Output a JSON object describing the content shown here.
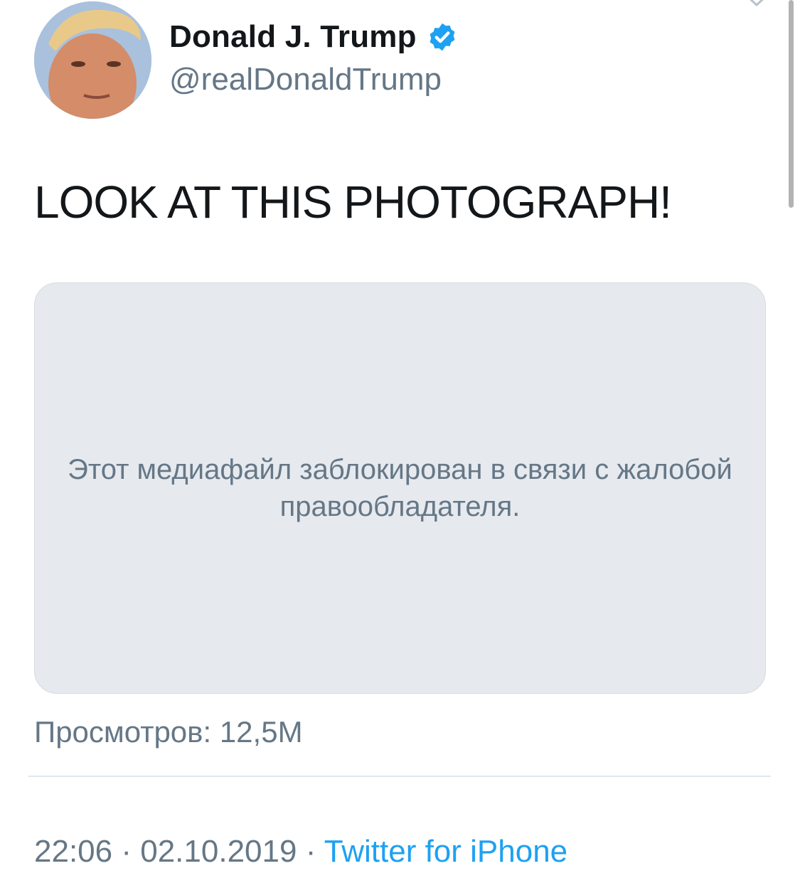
{
  "author": {
    "display_name": "Donald J. Trump",
    "handle": "@realDonaldTrump",
    "verified": true,
    "verified_color": "#1da1f2"
  },
  "tweet": {
    "text": "LOOK AT THIS PHOTOGRAPH!",
    "media_blocked_message": "Этот медиафайл заблокирован в связи с жалобой правообладателя.",
    "views": "Просмотров: 12,5M",
    "time": "22:06",
    "date": "02.10.2019",
    "separator": "·",
    "source": "Twitter for iPhone"
  },
  "icons": {
    "verified": "verified-check-icon",
    "menu": "chevron-down-icon"
  },
  "colors": {
    "primary_text": "#14171a",
    "secondary_text": "#657786",
    "link": "#1da1f2",
    "media_background": "#e6e9ee"
  }
}
